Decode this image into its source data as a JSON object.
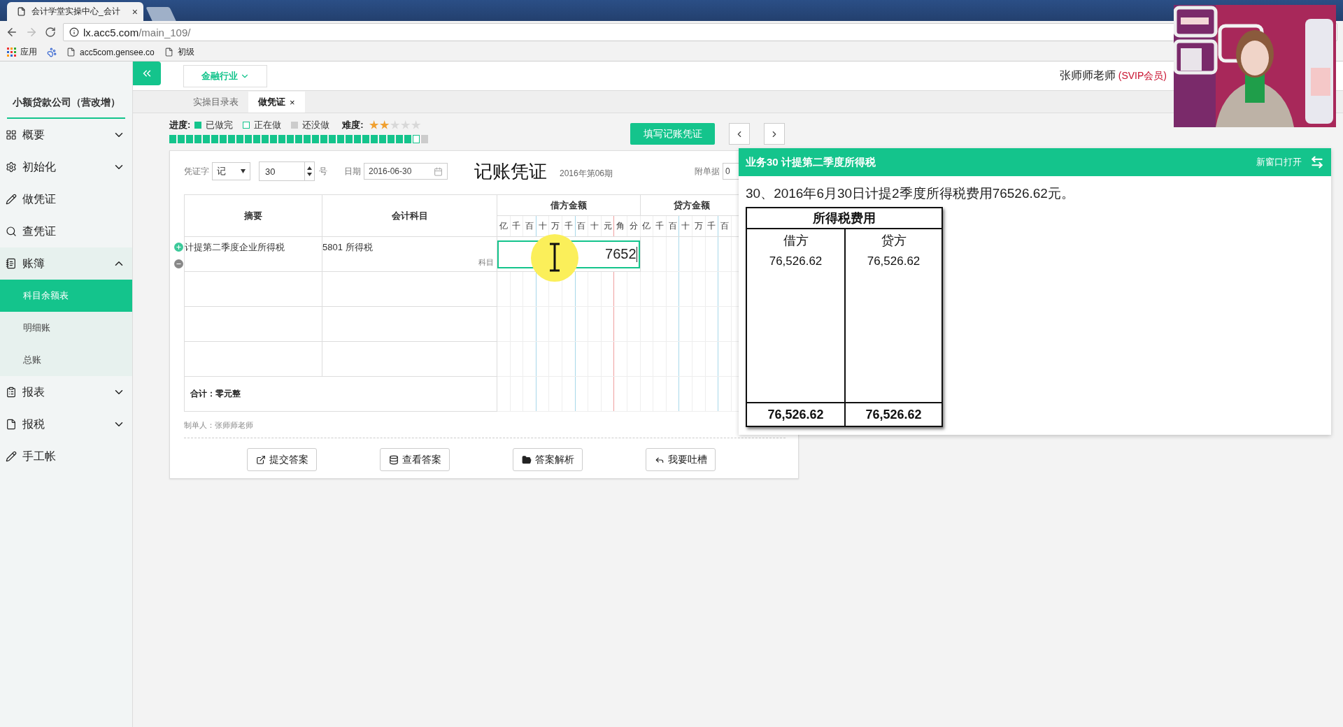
{
  "browser": {
    "tab_title": "会计学堂实操中心_会计",
    "tab_close": "×",
    "url_host": "lx.acc5.com",
    "url_path": "/main_109/",
    "bookmarks": [
      {
        "kind": "apps",
        "label": "应用"
      },
      {
        "kind": "paw"
      },
      {
        "kind": "page",
        "label": "acc5com.gensee.co"
      },
      {
        "kind": "page",
        "label": "初级"
      }
    ]
  },
  "sidebar": {
    "company": "小额贷款公司（营改增）",
    "items": [
      {
        "kind": "group",
        "label": "概要",
        "expanded": false
      },
      {
        "kind": "group",
        "label": "初始化",
        "expanded": false
      },
      {
        "kind": "link",
        "label": "做凭证"
      },
      {
        "kind": "link",
        "label": "查凭证"
      },
      {
        "kind": "group",
        "label": "账簿",
        "expanded": true,
        "children": [
          {
            "label": "科目余额表",
            "selected": true
          },
          {
            "label": "明细账",
            "selected": false
          },
          {
            "label": "总账",
            "selected": false
          }
        ]
      },
      {
        "kind": "group",
        "label": "报表",
        "expanded": false
      },
      {
        "kind": "group",
        "label": "报税",
        "expanded": false
      },
      {
        "kind": "link",
        "label": "手工帐"
      }
    ]
  },
  "toolbar": {
    "industry": "金融行业",
    "user": "张师师老师",
    "membership": "(SVIP会员)"
  },
  "tabs": [
    {
      "label": "实操目录表",
      "selected": false
    },
    {
      "label": "做凭证",
      "selected": true,
      "close": "×"
    }
  ],
  "progress": {
    "label": "进度:",
    "legend": [
      {
        "kind": "done",
        "label": "已做完"
      },
      {
        "kind": "current",
        "label": "正在做"
      },
      {
        "kind": "todo",
        "label": "还没做"
      }
    ],
    "segments": [
      {
        "kind": "done"
      },
      {
        "kind": "done"
      },
      {
        "kind": "done"
      },
      {
        "kind": "done"
      },
      {
        "kind": "done"
      },
      {
        "kind": "done"
      },
      {
        "kind": "done"
      },
      {
        "kind": "done"
      },
      {
        "kind": "done"
      },
      {
        "kind": "done"
      },
      {
        "kind": "done"
      },
      {
        "kind": "done"
      },
      {
        "kind": "done"
      },
      {
        "kind": "done"
      },
      {
        "kind": "done"
      },
      {
        "kind": "done"
      },
      {
        "kind": "done"
      },
      {
        "kind": "done"
      },
      {
        "kind": "done"
      },
      {
        "kind": "done"
      },
      {
        "kind": "done"
      },
      {
        "kind": "done"
      },
      {
        "kind": "done"
      },
      {
        "kind": "done"
      },
      {
        "kind": "done"
      },
      {
        "kind": "done"
      },
      {
        "kind": "done"
      },
      {
        "kind": "done"
      },
      {
        "kind": "done"
      },
      {
        "kind": "current"
      },
      {
        "kind": "todo"
      }
    ]
  },
  "difficulty": {
    "label": "难度:",
    "stars": 2
  },
  "fill_button": "填写记账凭证",
  "voucher": {
    "word_label": "凭证字",
    "word": "记",
    "number": "30",
    "number_suffix": "号",
    "date_label": "日期",
    "date": "2016-06-30",
    "title": "记账凭证",
    "period": "2016年第06期",
    "attachments_label": "附单据",
    "attachments": "0",
    "columns": {
      "summary": "摘要",
      "account": "会计科目",
      "debit": "借方金额",
      "credit": "贷方金额"
    },
    "debit_units": [
      "亿",
      "千",
      "百",
      "十",
      "万",
      "千",
      "百",
      "十",
      "元",
      "角",
      "分"
    ],
    "credit_units": [
      "亿",
      "千",
      "百",
      "十",
      "万",
      "千",
      "百"
    ],
    "rows": [
      {
        "kind": "entry",
        "summary": "计提第二季度企业所得税",
        "account": "5801 所得税",
        "account_hint": "科目",
        "debit_input": "7652"
      },
      {
        "kind": "blank"
      },
      {
        "kind": "blank"
      },
      {
        "kind": "blank"
      }
    ],
    "total": "合计：零元整",
    "maker": "制单人：张师师老师",
    "buttons": [
      {
        "kind": "external",
        "label": "提交答案"
      },
      {
        "kind": "database",
        "label": "查看答案"
      },
      {
        "kind": "folder",
        "label": "答案解析"
      },
      {
        "kind": "reply",
        "label": "我要吐槽"
      }
    ]
  },
  "task_panel": {
    "title": "业务30 计提第二季度所得税",
    "open_new": "新窗口打开",
    "description": "30、2016年6月30日计提2季度所得税费用76526.62元。",
    "t_account": {
      "title": "所得税费用",
      "debit_label": "借方",
      "credit_label": "贷方",
      "debit_entries": [
        "76,526.62"
      ],
      "credit_entries": [
        "76,526.62"
      ],
      "debit_total": "76,526.62",
      "credit_total": "76,526.62"
    }
  }
}
